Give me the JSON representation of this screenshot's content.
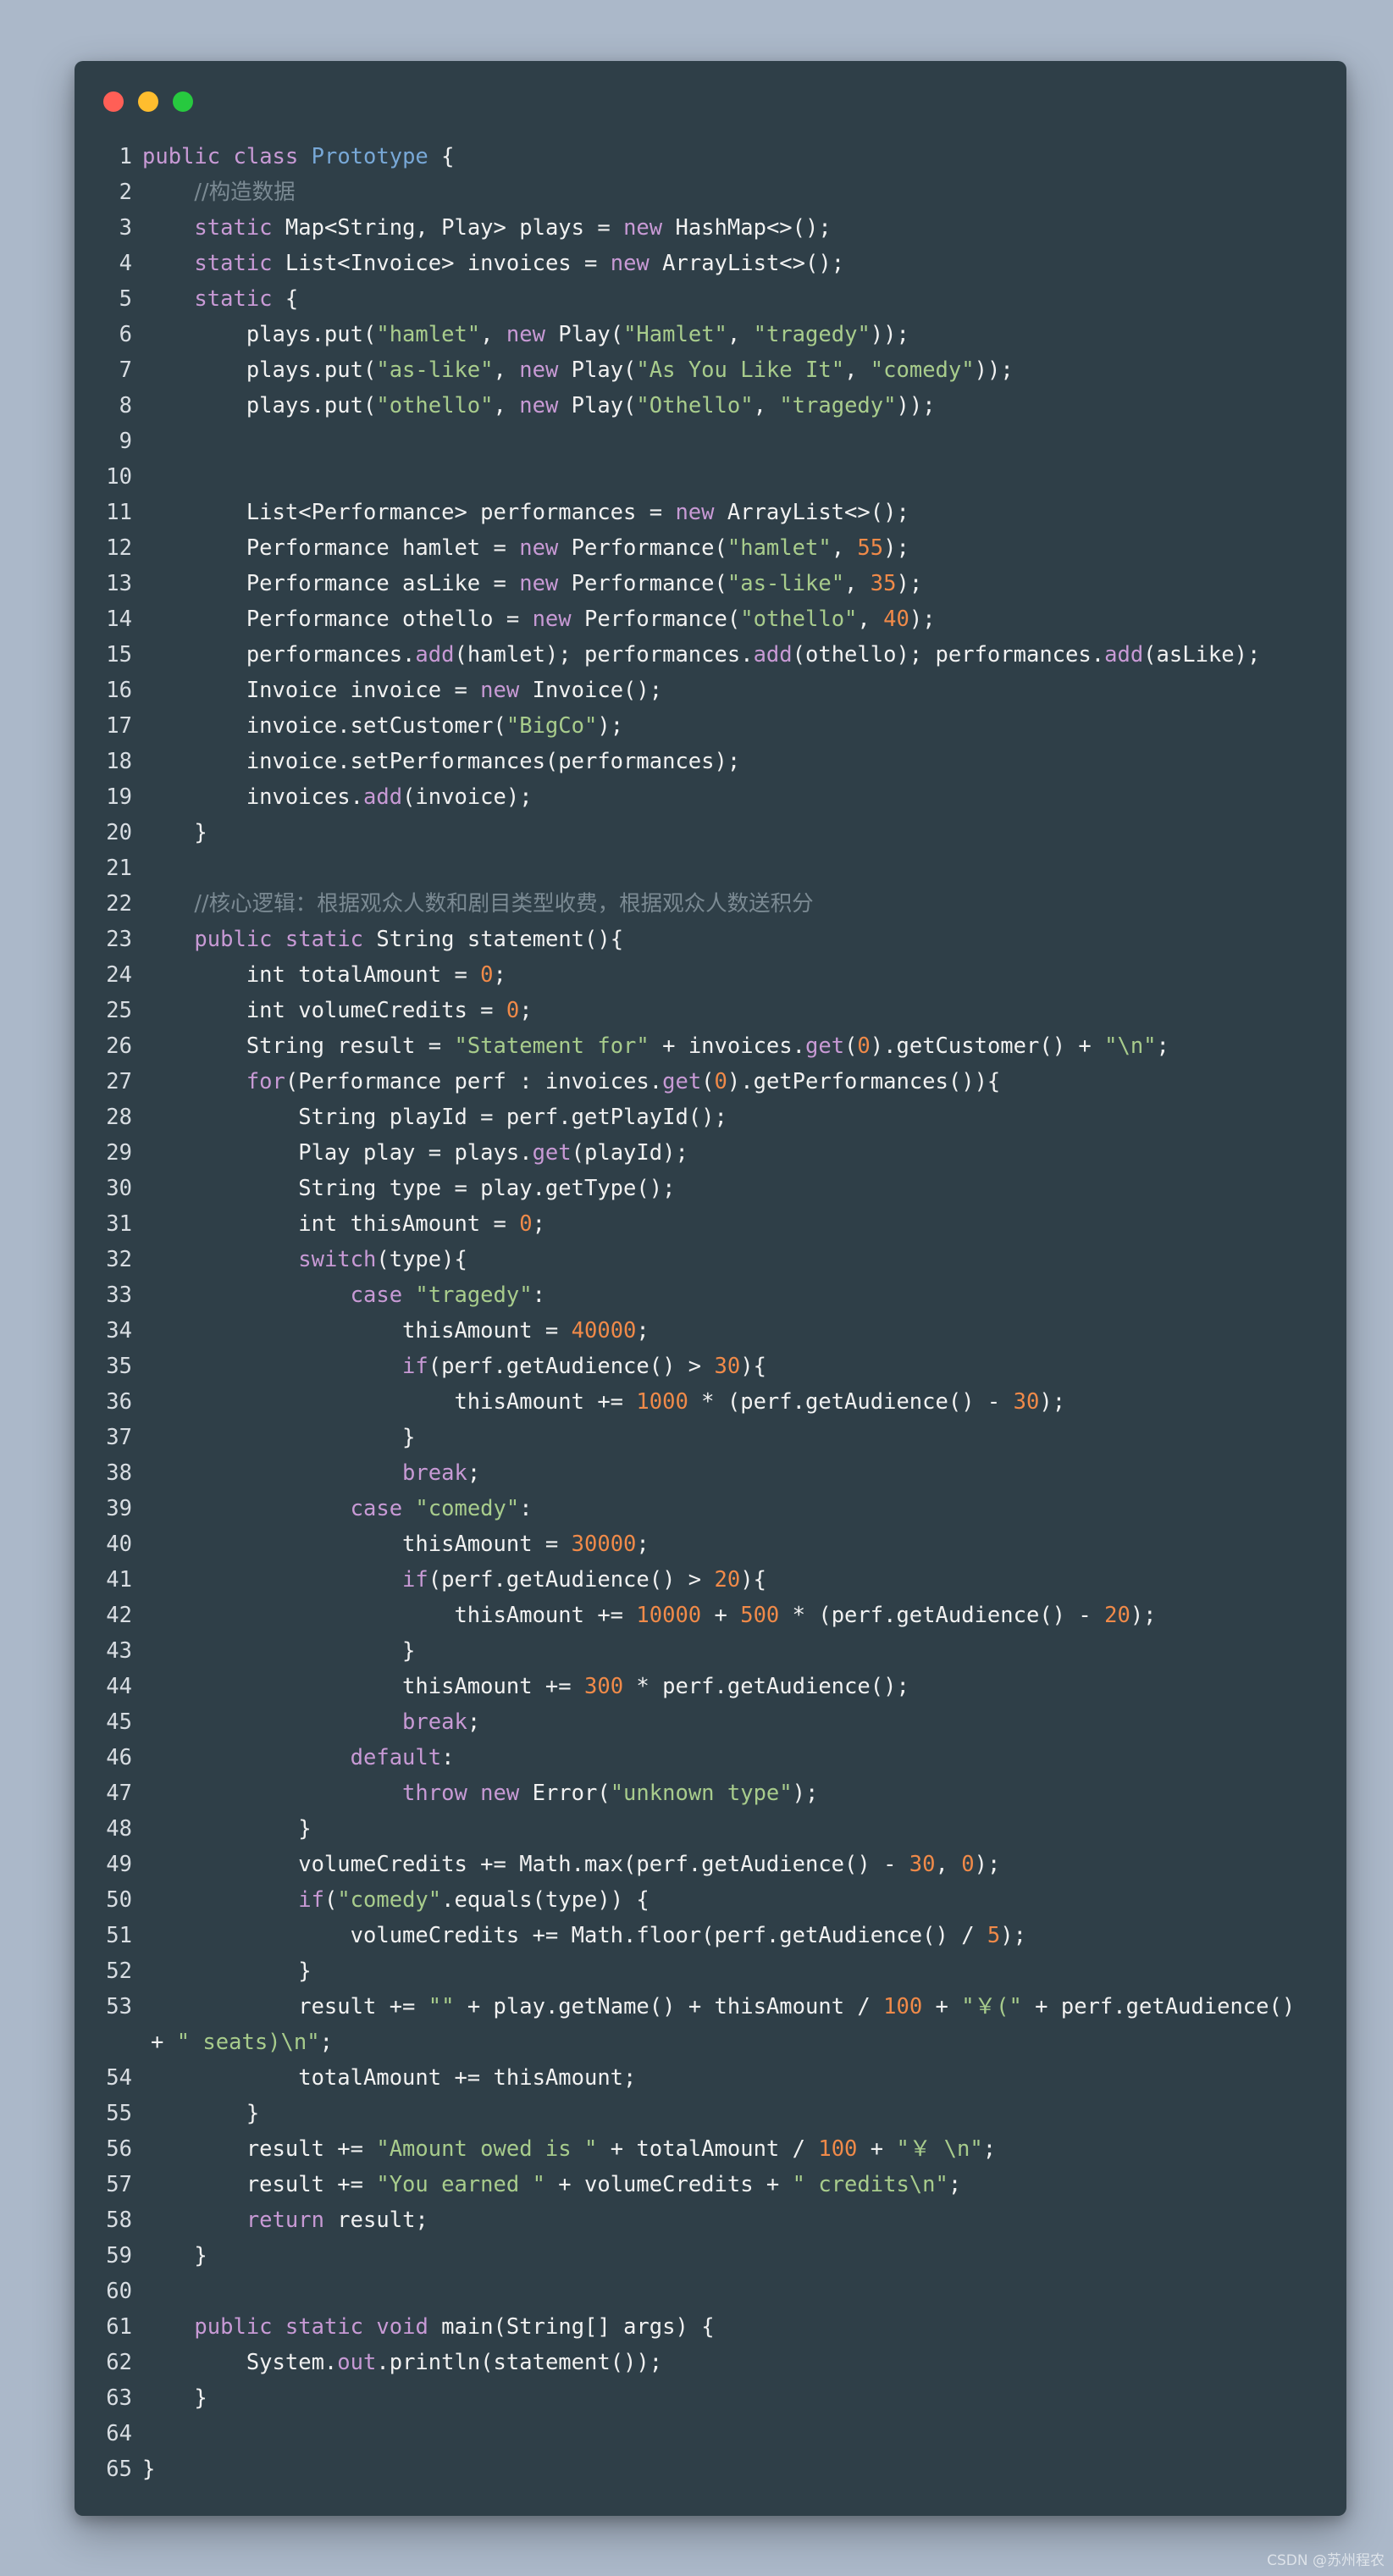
{
  "window": {
    "title": ""
  },
  "colors": {
    "page_background": "#abb8c9",
    "window_background": "#2f3f48",
    "keyword": "#c89ad5",
    "class_name": "#78a8d7",
    "string": "#a8cc8c",
    "number": "#f08a49",
    "comment": "#7b8a93"
  },
  "code": [
    {
      "n": 1,
      "parts": [
        [
          "kw",
          "public"
        ],
        [
          "txt",
          " "
        ],
        [
          "kw",
          "class"
        ],
        [
          "txt",
          " "
        ],
        [
          "cls",
          "Prototype"
        ],
        [
          "txt",
          " {"
        ]
      ]
    },
    {
      "n": 2,
      "parts": [
        [
          "txt",
          "    "
        ],
        [
          "com",
          "//构造数据"
        ]
      ]
    },
    {
      "n": 3,
      "parts": [
        [
          "txt",
          "    "
        ],
        [
          "kw",
          "static"
        ],
        [
          "txt",
          " Map<String, Play> plays = "
        ],
        [
          "kw",
          "new"
        ],
        [
          "txt",
          " HashMap<>();"
        ]
      ]
    },
    {
      "n": 4,
      "parts": [
        [
          "txt",
          "    "
        ],
        [
          "kw",
          "static"
        ],
        [
          "txt",
          " List<Invoice> invoices = "
        ],
        [
          "kw",
          "new"
        ],
        [
          "txt",
          " ArrayList<>();"
        ]
      ]
    },
    {
      "n": 5,
      "parts": [
        [
          "txt",
          "    "
        ],
        [
          "kw",
          "static"
        ],
        [
          "txt",
          " {"
        ]
      ]
    },
    {
      "n": 6,
      "parts": [
        [
          "txt",
          "        plays.put("
        ],
        [
          "str",
          "\"hamlet\""
        ],
        [
          "txt",
          ", "
        ],
        [
          "kw",
          "new"
        ],
        [
          "txt",
          " Play("
        ],
        [
          "str",
          "\"Hamlet\""
        ],
        [
          "txt",
          ", "
        ],
        [
          "str",
          "\"tragedy\""
        ],
        [
          "txt",
          "));"
        ]
      ]
    },
    {
      "n": 7,
      "parts": [
        [
          "txt",
          "        plays.put("
        ],
        [
          "str",
          "\"as-like\""
        ],
        [
          "txt",
          ", "
        ],
        [
          "kw",
          "new"
        ],
        [
          "txt",
          " Play("
        ],
        [
          "str",
          "\"As You Like It\""
        ],
        [
          "txt",
          ", "
        ],
        [
          "str",
          "\"comedy\""
        ],
        [
          "txt",
          "));"
        ]
      ]
    },
    {
      "n": 8,
      "parts": [
        [
          "txt",
          "        plays.put("
        ],
        [
          "str",
          "\"othello\""
        ],
        [
          "txt",
          ", "
        ],
        [
          "kw",
          "new"
        ],
        [
          "txt",
          " Play("
        ],
        [
          "str",
          "\"Othello\""
        ],
        [
          "txt",
          ", "
        ],
        [
          "str",
          "\"tragedy\""
        ],
        [
          "txt",
          "));"
        ]
      ]
    },
    {
      "n": 9,
      "parts": [
        [
          "txt",
          ""
        ]
      ]
    },
    {
      "n": 10,
      "parts": [
        [
          "txt",
          ""
        ]
      ]
    },
    {
      "n": 11,
      "parts": [
        [
          "txt",
          "        List<Performance> performances = "
        ],
        [
          "kw",
          "new"
        ],
        [
          "txt",
          " ArrayList<>();"
        ]
      ]
    },
    {
      "n": 12,
      "parts": [
        [
          "txt",
          "        Performance hamlet = "
        ],
        [
          "kw",
          "new"
        ],
        [
          "txt",
          " Performance("
        ],
        [
          "str",
          "\"hamlet\""
        ],
        [
          "txt",
          ", "
        ],
        [
          "num",
          "55"
        ],
        [
          "txt",
          ");"
        ]
      ]
    },
    {
      "n": 13,
      "parts": [
        [
          "txt",
          "        Performance asLike = "
        ],
        [
          "kw",
          "new"
        ],
        [
          "txt",
          " Performance("
        ],
        [
          "str",
          "\"as-like\""
        ],
        [
          "txt",
          ", "
        ],
        [
          "num",
          "35"
        ],
        [
          "txt",
          ");"
        ]
      ]
    },
    {
      "n": 14,
      "parts": [
        [
          "txt",
          "        Performance othello = "
        ],
        [
          "kw",
          "new"
        ],
        [
          "txt",
          " Performance("
        ],
        [
          "str",
          "\"othello\""
        ],
        [
          "txt",
          ", "
        ],
        [
          "num",
          "40"
        ],
        [
          "txt",
          ");"
        ]
      ]
    },
    {
      "n": 15,
      "parts": [
        [
          "txt",
          "        performances."
        ],
        [
          "kw",
          "add"
        ],
        [
          "txt",
          "(hamlet); performances."
        ],
        [
          "kw",
          "add"
        ],
        [
          "txt",
          "(othello); performances."
        ],
        [
          "kw",
          "add"
        ],
        [
          "txt",
          "(asLike);"
        ]
      ]
    },
    {
      "n": 16,
      "parts": [
        [
          "txt",
          "        Invoice invoice = "
        ],
        [
          "kw",
          "new"
        ],
        [
          "txt",
          " Invoice();"
        ]
      ]
    },
    {
      "n": 17,
      "parts": [
        [
          "txt",
          "        invoice.setCustomer("
        ],
        [
          "str",
          "\"BigCo\""
        ],
        [
          "txt",
          ");"
        ]
      ]
    },
    {
      "n": 18,
      "parts": [
        [
          "txt",
          "        invoice.setPerformances(performances);"
        ]
      ]
    },
    {
      "n": 19,
      "parts": [
        [
          "txt",
          "        invoices."
        ],
        [
          "kw",
          "add"
        ],
        [
          "txt",
          "(invoice);"
        ]
      ]
    },
    {
      "n": 20,
      "parts": [
        [
          "txt",
          "    }"
        ]
      ]
    },
    {
      "n": 21,
      "parts": [
        [
          "txt",
          ""
        ]
      ]
    },
    {
      "n": 22,
      "parts": [
        [
          "txt",
          "    "
        ],
        [
          "com",
          "//核心逻辑：根据观众人数和剧目类型收费，根据观众人数送积分"
        ]
      ]
    },
    {
      "n": 23,
      "parts": [
        [
          "txt",
          "    "
        ],
        [
          "kw",
          "public"
        ],
        [
          "txt",
          " "
        ],
        [
          "kw",
          "static"
        ],
        [
          "txt",
          " String statement(){"
        ]
      ]
    },
    {
      "n": 24,
      "parts": [
        [
          "txt",
          "        int totalAmount = "
        ],
        [
          "num",
          "0"
        ],
        [
          "txt",
          ";"
        ]
      ]
    },
    {
      "n": 25,
      "parts": [
        [
          "txt",
          "        int volumeCredits = "
        ],
        [
          "num",
          "0"
        ],
        [
          "txt",
          ";"
        ]
      ]
    },
    {
      "n": 26,
      "parts": [
        [
          "txt",
          "        String result = "
        ],
        [
          "str",
          "\"Statement for\""
        ],
        [
          "txt",
          " + invoices."
        ],
        [
          "kw",
          "get"
        ],
        [
          "txt",
          "("
        ],
        [
          "num",
          "0"
        ],
        [
          "txt",
          ").getCustomer() + "
        ],
        [
          "str",
          "\"\\n\""
        ],
        [
          "txt",
          ";"
        ]
      ]
    },
    {
      "n": 27,
      "parts": [
        [
          "txt",
          "        "
        ],
        [
          "kw",
          "for"
        ],
        [
          "txt",
          "(Performance perf : invoices."
        ],
        [
          "kw",
          "get"
        ],
        [
          "txt",
          "("
        ],
        [
          "num",
          "0"
        ],
        [
          "txt",
          ").getPerformances()){"
        ]
      ]
    },
    {
      "n": 28,
      "parts": [
        [
          "txt",
          "            String playId = perf.getPlayId();"
        ]
      ]
    },
    {
      "n": 29,
      "parts": [
        [
          "txt",
          "            Play play = plays."
        ],
        [
          "kw",
          "get"
        ],
        [
          "txt",
          "(playId);"
        ]
      ]
    },
    {
      "n": 30,
      "parts": [
        [
          "txt",
          "            String type = play.getType();"
        ]
      ]
    },
    {
      "n": 31,
      "parts": [
        [
          "txt",
          "            int thisAmount = "
        ],
        [
          "num",
          "0"
        ],
        [
          "txt",
          ";"
        ]
      ]
    },
    {
      "n": 32,
      "parts": [
        [
          "txt",
          "            "
        ],
        [
          "kw",
          "switch"
        ],
        [
          "txt",
          "(type){"
        ]
      ]
    },
    {
      "n": 33,
      "parts": [
        [
          "txt",
          "                "
        ],
        [
          "kw",
          "case"
        ],
        [
          "txt",
          " "
        ],
        [
          "str",
          "\"tragedy\""
        ],
        [
          "txt",
          ":"
        ]
      ]
    },
    {
      "n": 34,
      "parts": [
        [
          "txt",
          "                    thisAmount = "
        ],
        [
          "num",
          "40000"
        ],
        [
          "txt",
          ";"
        ]
      ]
    },
    {
      "n": 35,
      "parts": [
        [
          "txt",
          "                    "
        ],
        [
          "kw",
          "if"
        ],
        [
          "txt",
          "(perf.getAudience() > "
        ],
        [
          "num",
          "30"
        ],
        [
          "txt",
          "){"
        ]
      ]
    },
    {
      "n": 36,
      "parts": [
        [
          "txt",
          "                        thisAmount += "
        ],
        [
          "num",
          "1000"
        ],
        [
          "txt",
          " * (perf.getAudience() - "
        ],
        [
          "num",
          "30"
        ],
        [
          "txt",
          ");"
        ]
      ]
    },
    {
      "n": 37,
      "parts": [
        [
          "txt",
          "                    }"
        ]
      ]
    },
    {
      "n": 38,
      "parts": [
        [
          "txt",
          "                    "
        ],
        [
          "kw",
          "break"
        ],
        [
          "txt",
          ";"
        ]
      ]
    },
    {
      "n": 39,
      "parts": [
        [
          "txt",
          "                "
        ],
        [
          "kw",
          "case"
        ],
        [
          "txt",
          " "
        ],
        [
          "str",
          "\"comedy\""
        ],
        [
          "txt",
          ":"
        ]
      ]
    },
    {
      "n": 40,
      "parts": [
        [
          "txt",
          "                    thisAmount = "
        ],
        [
          "num",
          "30000"
        ],
        [
          "txt",
          ";"
        ]
      ]
    },
    {
      "n": 41,
      "parts": [
        [
          "txt",
          "                    "
        ],
        [
          "kw",
          "if"
        ],
        [
          "txt",
          "(perf.getAudience() > "
        ],
        [
          "num",
          "20"
        ],
        [
          "txt",
          "){"
        ]
      ]
    },
    {
      "n": 42,
      "parts": [
        [
          "txt",
          "                        thisAmount += "
        ],
        [
          "num",
          "10000"
        ],
        [
          "txt",
          " + "
        ],
        [
          "num",
          "500"
        ],
        [
          "txt",
          " * (perf.getAudience() - "
        ],
        [
          "num",
          "20"
        ],
        [
          "txt",
          ");"
        ]
      ]
    },
    {
      "n": 43,
      "parts": [
        [
          "txt",
          "                    }"
        ]
      ]
    },
    {
      "n": 44,
      "parts": [
        [
          "txt",
          "                    thisAmount += "
        ],
        [
          "num",
          "300"
        ],
        [
          "txt",
          " * perf.getAudience();"
        ]
      ]
    },
    {
      "n": 45,
      "parts": [
        [
          "txt",
          "                    "
        ],
        [
          "kw",
          "break"
        ],
        [
          "txt",
          ";"
        ]
      ]
    },
    {
      "n": 46,
      "parts": [
        [
          "txt",
          "                "
        ],
        [
          "kw",
          "default"
        ],
        [
          "txt",
          ":"
        ]
      ]
    },
    {
      "n": 47,
      "parts": [
        [
          "txt",
          "                    "
        ],
        [
          "kw",
          "throw"
        ],
        [
          "txt",
          " "
        ],
        [
          "kw",
          "new"
        ],
        [
          "txt",
          " Error("
        ],
        [
          "str",
          "\"unknown type\""
        ],
        [
          "txt",
          ");"
        ]
      ]
    },
    {
      "n": 48,
      "parts": [
        [
          "txt",
          "            }"
        ]
      ]
    },
    {
      "n": 49,
      "parts": [
        [
          "txt",
          "            volumeCredits += Math.max(perf.getAudience() - "
        ],
        [
          "num",
          "30"
        ],
        [
          "txt",
          ", "
        ],
        [
          "num",
          "0"
        ],
        [
          "txt",
          ");"
        ]
      ]
    },
    {
      "n": 50,
      "parts": [
        [
          "txt",
          "            "
        ],
        [
          "kw",
          "if"
        ],
        [
          "txt",
          "("
        ],
        [
          "str",
          "\"comedy\""
        ],
        [
          "txt",
          ".equals(type)) {"
        ]
      ]
    },
    {
      "n": 51,
      "parts": [
        [
          "txt",
          "                volumeCredits += Math.floor(perf.getAudience() / "
        ],
        [
          "num",
          "5"
        ],
        [
          "txt",
          ");"
        ]
      ]
    },
    {
      "n": 52,
      "parts": [
        [
          "txt",
          "            }"
        ]
      ]
    },
    {
      "n": 53,
      "parts": [
        [
          "txt",
          "            result += "
        ],
        [
          "str",
          "\"\""
        ],
        [
          "txt",
          " + play.getName() + thisAmount / "
        ],
        [
          "num",
          "100"
        ],
        [
          "txt",
          " + "
        ],
        [
          "str",
          "\"￥(\""
        ],
        [
          "txt",
          " + perf.getAudience()"
        ]
      ]
    },
    {
      "n": "",
      "wrap": true,
      "parts": [
        [
          "txt",
          "+ "
        ],
        [
          "str",
          "\" seats)\\n\""
        ],
        [
          "txt",
          ";"
        ]
      ]
    },
    {
      "n": 54,
      "parts": [
        [
          "txt",
          "            totalAmount += thisAmount;"
        ]
      ]
    },
    {
      "n": 55,
      "parts": [
        [
          "txt",
          "        }"
        ]
      ]
    },
    {
      "n": 56,
      "parts": [
        [
          "txt",
          "        result += "
        ],
        [
          "str",
          "\"Amount owed is \""
        ],
        [
          "txt",
          " + totalAmount / "
        ],
        [
          "num",
          "100"
        ],
        [
          "txt",
          " + "
        ],
        [
          "str",
          "\"￥ \\n\""
        ],
        [
          "txt",
          ";"
        ]
      ]
    },
    {
      "n": 57,
      "parts": [
        [
          "txt",
          "        result += "
        ],
        [
          "str",
          "\"You earned \""
        ],
        [
          "txt",
          " + volumeCredits + "
        ],
        [
          "str",
          "\" credits\\n\""
        ],
        [
          "txt",
          ";"
        ]
      ]
    },
    {
      "n": 58,
      "parts": [
        [
          "txt",
          "        "
        ],
        [
          "kw",
          "return"
        ],
        [
          "txt",
          " result;"
        ]
      ]
    },
    {
      "n": 59,
      "parts": [
        [
          "txt",
          "    }"
        ]
      ]
    },
    {
      "n": 60,
      "parts": [
        [
          "txt",
          ""
        ]
      ]
    },
    {
      "n": 61,
      "parts": [
        [
          "txt",
          "    "
        ],
        [
          "kw",
          "public"
        ],
        [
          "txt",
          " "
        ],
        [
          "kw",
          "static"
        ],
        [
          "txt",
          " "
        ],
        [
          "kw",
          "void"
        ],
        [
          "txt",
          " main(String[] args) {"
        ]
      ]
    },
    {
      "n": 62,
      "parts": [
        [
          "txt",
          "        System."
        ],
        [
          "kw",
          "out"
        ],
        [
          "txt",
          ".println(statement());"
        ]
      ]
    },
    {
      "n": 63,
      "parts": [
        [
          "txt",
          "    }"
        ]
      ]
    },
    {
      "n": 64,
      "parts": [
        [
          "txt",
          ""
        ]
      ]
    },
    {
      "n": 65,
      "parts": [
        [
          "txt",
          "}"
        ]
      ]
    }
  ],
  "watermark": "CSDN @苏州程农"
}
